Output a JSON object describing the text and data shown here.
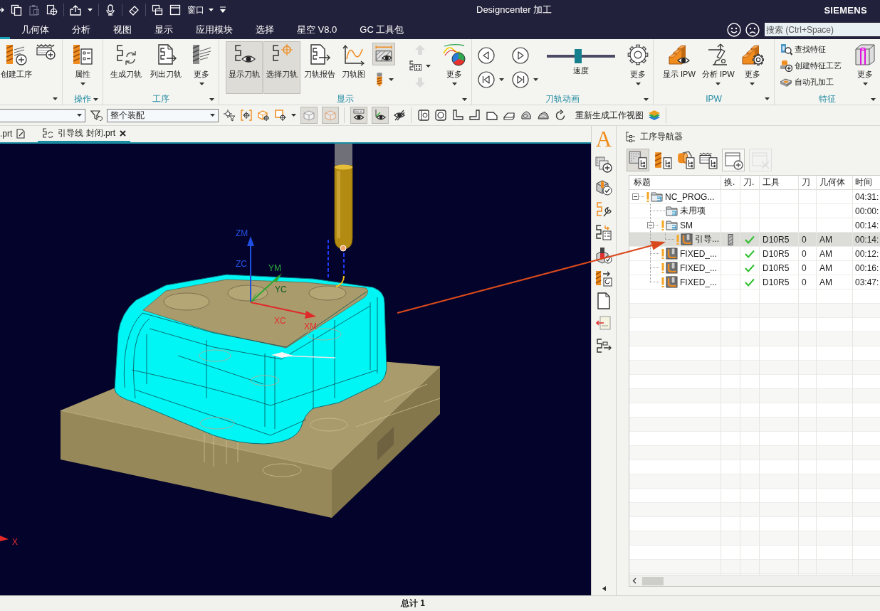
{
  "title_bar": {
    "quick_access": [
      {
        "items": [
          {
            "kind": "icon",
            "disabled": false
          },
          {
            "kind": "icon",
            "disabled": false
          },
          {
            "kind": "icon",
            "disabled": true
          },
          {
            "kind": "icon",
            "disabled": false
          }
        ]
      },
      {
        "items": [
          {
            "kind": "icon",
            "disabled": false,
            "dropdown": true
          }
        ]
      },
      {
        "items": [
          {
            "kind": "icon",
            "disabled": false
          }
        ]
      },
      {
        "items": [
          {
            "kind": "icon",
            "disabled": false
          }
        ]
      },
      {
        "items": [
          {
            "kind": "icon",
            "disabled": false
          },
          {
            "kind": "icon",
            "disabled": false
          },
          {
            "kind": "menu",
            "label": "窗口",
            "dropdown": true
          },
          {
            "kind": "customize"
          }
        ]
      }
    ],
    "title": "Designcenter 加工",
    "brand": "SIEMENS"
  },
  "tabs": [
    {
      "label": "几何体",
      "selected": false
    },
    {
      "label": "分析",
      "selected": false
    },
    {
      "label": "视图",
      "selected": false
    },
    {
      "label": "显示",
      "selected": false
    },
    {
      "label": "应用模块",
      "selected": false
    },
    {
      "label": "选择",
      "selected": false
    },
    {
      "label": "星空 V8.0",
      "selected": false
    },
    {
      "label": "GC 工具包",
      "selected": false
    }
  ],
  "search": {
    "placeholder": "搜索 (Ctrl+Space)"
  },
  "ribbon": {
    "groups": [
      {
        "dropdown": true,
        "items": [
          {
            "kind": "large",
            "label": "创建工序",
            "pressed": false
          },
          {
            "kind": "icon",
            "pressed": false
          }
        ]
      },
      {
        "label": "操作",
        "dropdown": true,
        "items": [
          {
            "kind": "large",
            "label": "属性",
            "dropdown": true,
            "pressed": false
          }
        ]
      },
      {
        "label": "工序",
        "dropdown": true,
        "items": [
          {
            "kind": "large",
            "label": "生成刀轨",
            "pressed": false
          },
          {
            "kind": "large",
            "label": "列出刀轨",
            "pressed": false
          },
          {
            "kind": "large",
            "label": "更多",
            "dropdown": true,
            "pressed": false
          }
        ]
      },
      {
        "label": "显示",
        "dropdown": true,
        "items": [
          {
            "kind": "large",
            "label": "显示刀轨",
            "pressed": true
          },
          {
            "kind": "large",
            "label": "选择刀轨",
            "pressed": true
          },
          {
            "kind": "large",
            "label": "刀轨报告",
            "pressed": false
          },
          {
            "kind": "large",
            "label": "刀轨图",
            "pressed": false
          },
          {
            "kind": "stack",
            "items": [
              {
                "pressed": true,
                "disabled": false
              },
              {
                "pressed": false,
                "disabled": false,
                "dropdown": true
              }
            ]
          },
          {
            "kind": "stack",
            "items": [
              {
                "pressed": false,
                "disabled": true
              },
              {
                "pressed": false,
                "disabled": false,
                "dropdown": true
              },
              {
                "pressed": false,
                "disabled": true
              }
            ]
          },
          {
            "kind": "large",
            "label": "更多",
            "dropdown": true,
            "pressed": false
          }
        ]
      },
      {
        "label": "刀轨动画",
        "dropdown": true,
        "items": [
          {
            "kind": "grid",
            "items": [
              {
                "dropdown": false
              },
              {
                "dropdown": false
              },
              {
                "dropdown": true
              },
              {
                "dropdown": true
              }
            ]
          },
          {
            "kind": "slider",
            "label": "速度",
            "level": 0.46
          },
          {
            "kind": "large",
            "label": "更多",
            "dropdown": true,
            "pressed": false
          }
        ]
      },
      {
        "label": "IPW",
        "dropdown": true,
        "items": [
          {
            "kind": "large",
            "label": "显示 IPW",
            "pressed": false
          },
          {
            "kind": "large",
            "label": "分析 IPW",
            "dropdown": true,
            "pressed": false
          },
          {
            "kind": "large",
            "label": "更多",
            "dropdown": true,
            "pressed": false
          }
        ]
      },
      {
        "label": "特征",
        "dropdown": true,
        "items": [
          {
            "kind": "list",
            "items": [
              {
                "label": "查找特征"
              },
              {
                "label": "创建特征工艺"
              },
              {
                "label": "自动孔加工"
              }
            ]
          },
          {
            "kind": "large",
            "label": "更多",
            "dropdown": true,
            "pressed": false
          }
        ]
      }
    ]
  },
  "toolbar": {
    "groups": [
      {
        "items": [
          {
            "kind": "select"
          },
          {
            "kind": "icon",
            "pressed": false
          },
          {
            "kind": "select",
            "value": "整个装配"
          },
          {
            "kind": "icon",
            "pressed": false
          },
          {
            "kind": "icon",
            "pressed": false
          },
          {
            "kind": "icon",
            "pressed": false
          },
          {
            "kind": "icon",
            "pressed": false,
            "dropdown": true
          },
          {
            "kind": "icon",
            "pressed": true
          },
          {
            "kind": "icon",
            "pressed": true
          }
        ]
      },
      {
        "items": [
          {
            "kind": "icon",
            "pressed": true
          },
          {
            "kind": "icon",
            "pressed": true
          },
          {
            "kind": "icon",
            "pressed": false
          }
        ]
      },
      {
        "items": [
          {
            "kind": "icon",
            "pressed": false
          },
          {
            "kind": "icon",
            "pressed": false
          },
          {
            "kind": "icon",
            "pressed": false
          },
          {
            "kind": "icon",
            "pressed": false
          },
          {
            "kind": "icon",
            "pressed": false
          },
          {
            "kind": "icon",
            "pressed": false
          },
          {
            "kind": "icon",
            "pressed": false
          },
          {
            "kind": "icon",
            "pressed": false
          },
          {
            "kind": "icon",
            "pressed": false
          },
          {
            "kind": "text",
            "label": "重新生成工作视图"
          },
          {
            "kind": "icon",
            "pressed": false
          }
        ]
      }
    ]
  },
  "document_tabs": [
    {
      "label": ".prt",
      "selected": false
    },
    {
      "label": "引导线 封闭.prt",
      "selected": true
    }
  ],
  "viewport": {
    "triad_labels": [
      {
        "label": "ZM",
        "color": "#2454ea"
      },
      {
        "label": "ZC",
        "color": "#2454ea"
      },
      {
        "label": "YM",
        "color": "#2fae3a"
      },
      {
        "label": "YC",
        "color": "#0a5a22"
      },
      {
        "label": "XC",
        "color": "#e53030"
      },
      {
        "label": "XM",
        "color": "#e53030"
      }
    ],
    "corner_label": "X"
  },
  "resource_bar": {
    "glyph": "A"
  },
  "operation_navigator": {
    "title": "工序导航器",
    "toolbar": [
      {
        "pressed": true,
        "disabled": false
      },
      {
        "pressed": false,
        "disabled": false
      },
      {
        "pressed": false,
        "disabled": false
      },
      {
        "pressed": false,
        "disabled": false
      },
      {
        "pressed": false,
        "disabled": false
      },
      {
        "pressed": false,
        "disabled": true
      }
    ],
    "columns": [
      "标题",
      "换.",
      "刀.",
      "工具",
      "刀",
      "几何体",
      "时间"
    ],
    "rows": [
      {
        "kind": "group",
        "label": "NC_PROG...",
        "flagged": true,
        "expanded": true,
        "selected": false,
        "tool_change": false,
        "toolpath": false,
        "time": "04:31:",
        "children": [
          {
            "kind": "group",
            "label": "未用项",
            "flagged": false,
            "selected": false,
            "tool_change": false,
            "toolpath": false,
            "time": "00:00:"
          },
          {
            "kind": "group",
            "label": "SM",
            "flagged": true,
            "expanded": true,
            "selected": false,
            "tool_change": false,
            "toolpath": false,
            "time": "00:14:",
            "children": [
              {
                "kind": "operation",
                "label": "引导...",
                "flagged": true,
                "selected": true,
                "tool_change": true,
                "toolpath": true,
                "tool": "D10R5",
                "tool_number": "0",
                "geometry": "AM",
                "time": "00:14:"
              }
            ]
          },
          {
            "kind": "operation",
            "label": "FIXED_...",
            "flagged": true,
            "selected": false,
            "tool_change": false,
            "toolpath": true,
            "tool": "D10R5",
            "tool_number": "0",
            "geometry": "AM",
            "time": "00:12:"
          },
          {
            "kind": "operation",
            "label": "FIXED_...",
            "flagged": true,
            "selected": false,
            "tool_change": false,
            "toolpath": true,
            "tool": "D10R5",
            "tool_number": "0",
            "geometry": "AM",
            "time": "00:16:"
          },
          {
            "kind": "operation",
            "label": "FIXED_...",
            "flagged": true,
            "selected": false,
            "tool_change": false,
            "toolpath": true,
            "tool": "D10R5",
            "tool_number": "0",
            "geometry": "AM",
            "time": "03:47:"
          }
        ]
      }
    ]
  },
  "status_bar": {
    "text": "总计 1"
  }
}
